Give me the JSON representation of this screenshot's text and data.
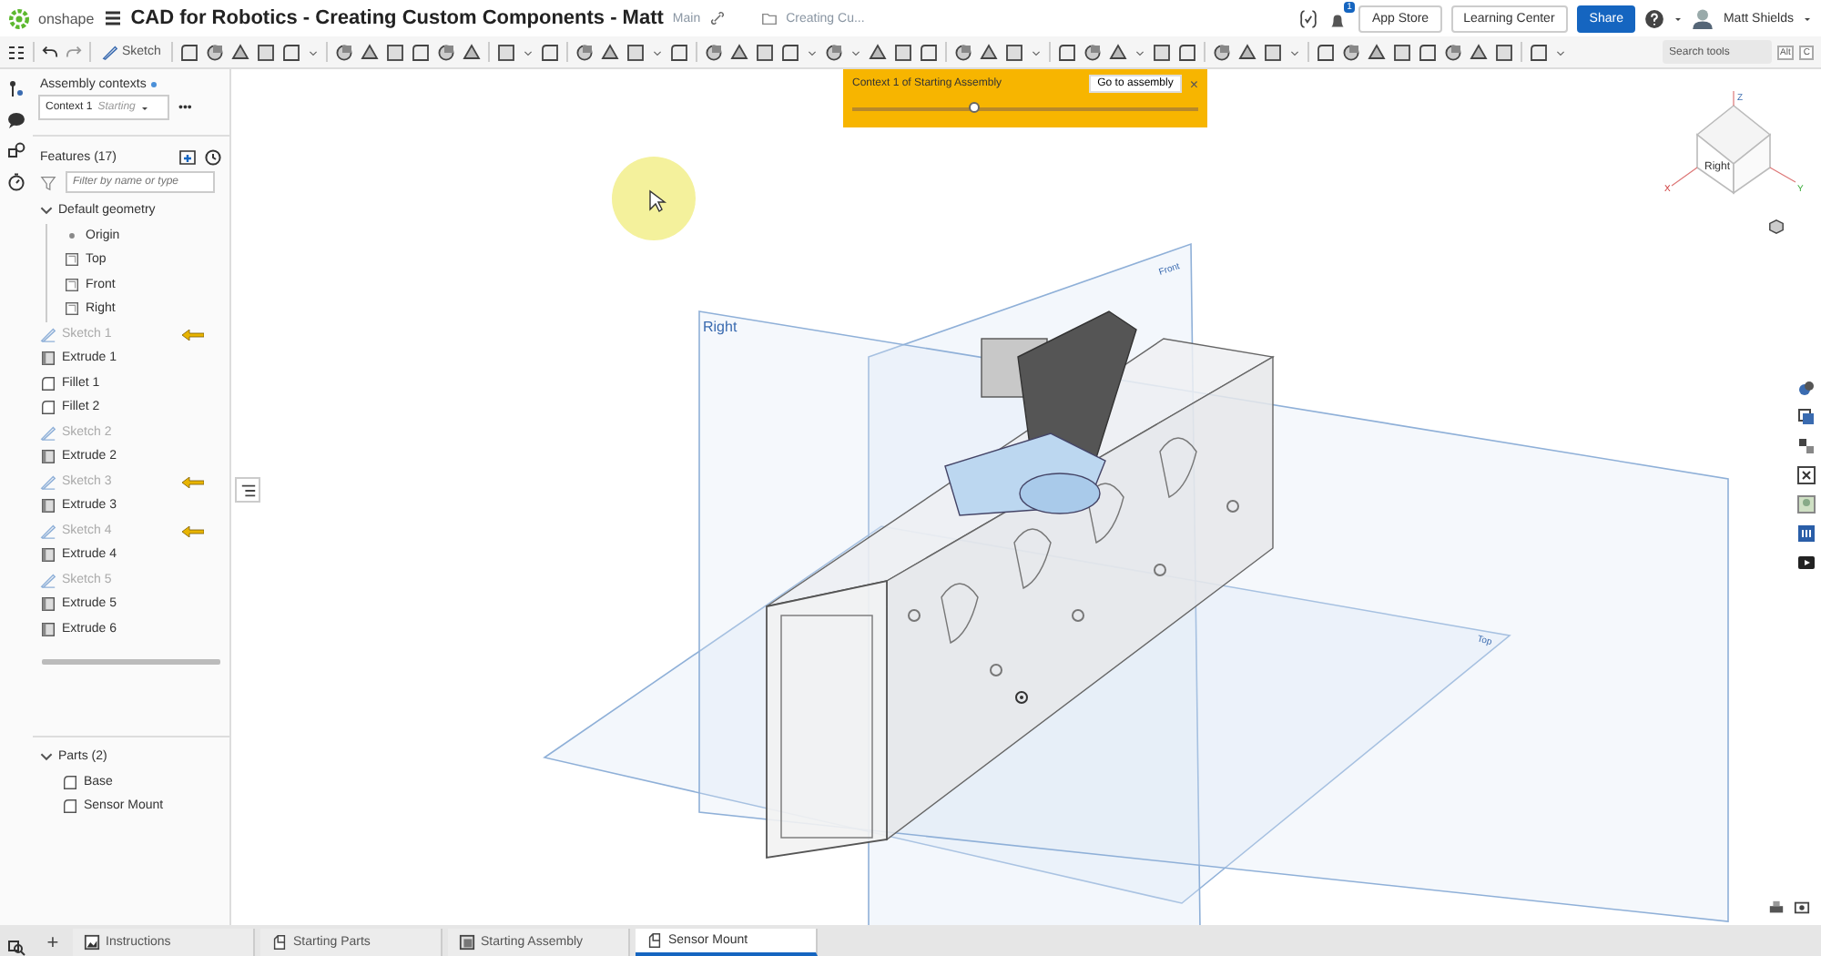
{
  "header": {
    "logo": "onshape",
    "title": "CAD for Robotics - Creating Custom Components - Matt",
    "branch": "Main",
    "folder": "Creating Cu...",
    "notifications": "1",
    "buttons": [
      {
        "label": "App Store",
        "kind": "plain"
      },
      {
        "label": "Learning Center",
        "kind": "plain"
      },
      {
        "label": "Share",
        "kind": "primary"
      }
    ],
    "user": "Matt Shields"
  },
  "toolbar": {
    "sketch_label": "Sketch",
    "search": {
      "placeholder": "Search tools"
    },
    "shortcut": [
      "Alt",
      "C"
    ]
  },
  "contexts": {
    "title": "Assembly contexts",
    "context": "Context 1",
    "context_state": "Starting",
    "more": "•••"
  },
  "features": {
    "title": "Features (17)",
    "filter": {
      "placeholder": "Filter by name or type"
    },
    "items": [
      {
        "label": "Default geometry",
        "kind": "folder",
        "expanded": true,
        "hidden": false,
        "flagged": false,
        "children": [
          {
            "label": "Origin",
            "kind": "origin",
            "hidden": false,
            "flagged": false
          },
          {
            "label": "Top",
            "kind": "plane",
            "hidden": false,
            "flagged": false
          },
          {
            "label": "Front",
            "kind": "plane",
            "hidden": false,
            "flagged": false
          },
          {
            "label": "Right",
            "kind": "plane",
            "hidden": false,
            "flagged": false
          }
        ]
      },
      {
        "label": "Sketch 1",
        "kind": "sketch",
        "hidden": true,
        "flagged": true
      },
      {
        "label": "Extrude 1",
        "kind": "extrude",
        "hidden": false,
        "flagged": false
      },
      {
        "label": "Fillet 1",
        "kind": "fillet",
        "hidden": false,
        "flagged": false
      },
      {
        "label": "Fillet 2",
        "kind": "fillet",
        "hidden": false,
        "flagged": false
      },
      {
        "label": "Sketch 2",
        "kind": "sketch",
        "hidden": true,
        "flagged": false
      },
      {
        "label": "Extrude 2",
        "kind": "extrude",
        "hidden": false,
        "flagged": false
      },
      {
        "label": "Sketch 3",
        "kind": "sketch",
        "hidden": true,
        "flagged": true
      },
      {
        "label": "Extrude 3",
        "kind": "extrude",
        "hidden": false,
        "flagged": false
      },
      {
        "label": "Sketch 4",
        "kind": "sketch",
        "hidden": true,
        "flagged": true
      },
      {
        "label": "Extrude 4",
        "kind": "extrude",
        "hidden": false,
        "flagged": false
      },
      {
        "label": "Sketch 5",
        "kind": "sketch",
        "hidden": true,
        "flagged": false
      },
      {
        "label": "Extrude 5",
        "kind": "extrude",
        "hidden": false,
        "flagged": false
      },
      {
        "label": "Extrude 6",
        "kind": "extrude",
        "hidden": false,
        "flagged": false
      }
    ]
  },
  "parts": {
    "title": "Parts (2)",
    "expanded": true,
    "items": [
      {
        "label": "Base"
      },
      {
        "label": "Sensor Mount"
      }
    ]
  },
  "banner": {
    "text": "Context 1 of Starting Assembly",
    "button": "Go to assembly",
    "close": "×",
    "level": 0.35
  },
  "viewport": {
    "plane_labels": [
      {
        "label": "Right"
      },
      {
        "label": "Front"
      },
      {
        "label": "Top"
      }
    ],
    "view_cube": {
      "face": "Right",
      "axes": [
        "Z",
        "X",
        "Y"
      ]
    }
  },
  "add_tab": "+",
  "tabs": [
    {
      "label": "Instructions",
      "kind": "document",
      "selected": false
    },
    {
      "label": "Starting Parts",
      "kind": "part",
      "selected": false
    },
    {
      "label": "Starting Assembly",
      "kind": "assembly",
      "selected": false
    },
    {
      "label": "Sensor Mount",
      "kind": "part",
      "selected": true
    }
  ]
}
